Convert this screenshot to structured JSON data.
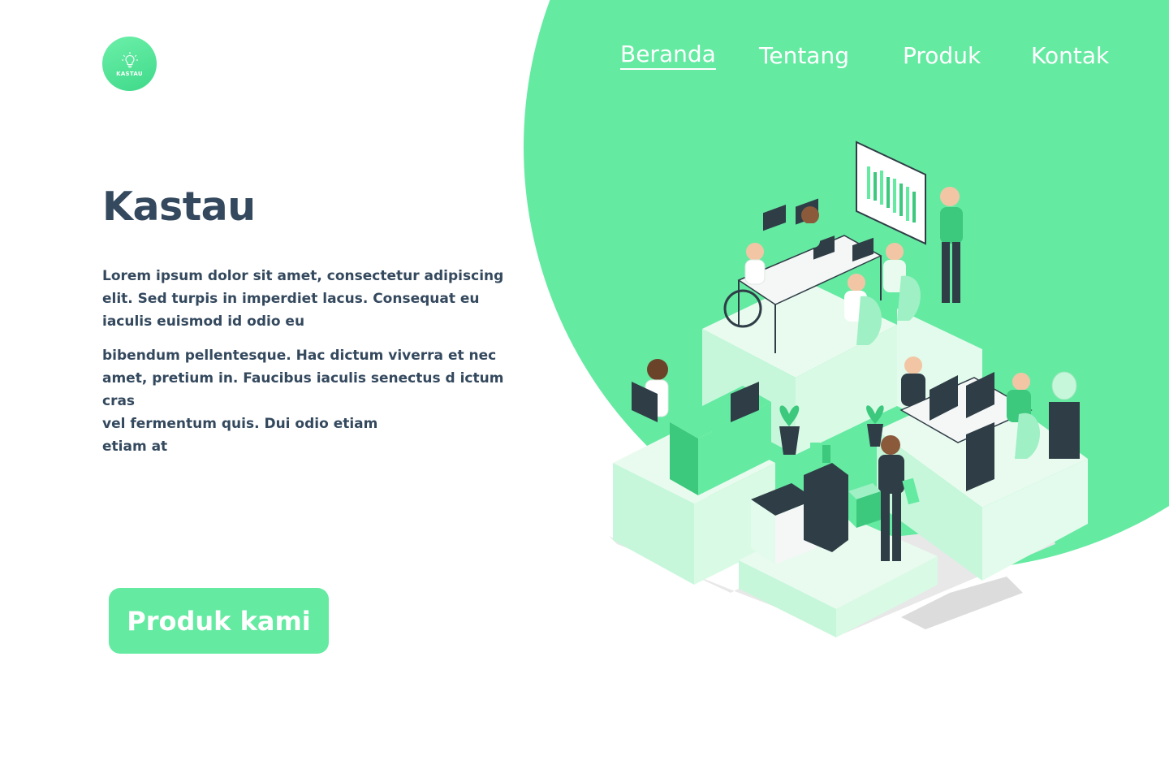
{
  "brand": {
    "logo_text": "KASTAU",
    "accent_color": "#65eaa2",
    "text_color": "#34495e"
  },
  "nav": {
    "items": [
      {
        "label": "Beranda",
        "active": true
      },
      {
        "label": "Tentang",
        "active": false
      },
      {
        "label": "Produk",
        "active": false
      },
      {
        "label": "Kontak",
        "active": false
      }
    ]
  },
  "hero": {
    "title": "Kastau",
    "paragraph_1": "Lorem ipsum dolor sit amet, consectetur  adipiscing elit. Sed turpis in imperdiet lacus. Consequat eu iaculis euismod id odio eu",
    "paragraph_2_lines": [
      "bibendum pellentesque. Hac dictum viverra et nec",
      "amet, pretium in. Faucibus iaculis senectus d ictum cras",
      "vel fermentum quis. Dui odio etiam",
      "etiam at"
    ],
    "cta_label": "Produk kami"
  },
  "illustration": {
    "icon": "isometric-office-illustration"
  }
}
